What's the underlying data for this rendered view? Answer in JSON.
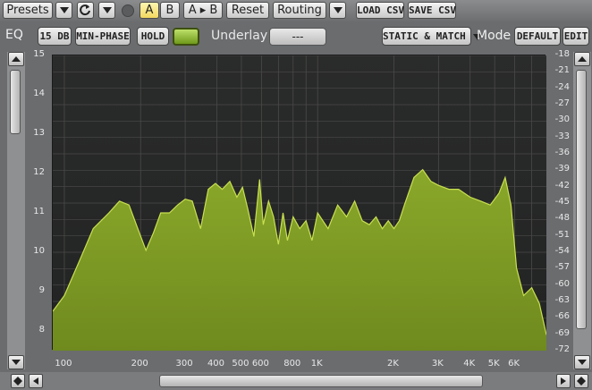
{
  "toolbar": {
    "presets_label": "Presets",
    "ab_a": "A",
    "ab_b": "B",
    "ab_copy": "A ▸ B",
    "reset_label": "Reset",
    "routing_label": "Routing",
    "load_csv": "LOAD CSV",
    "save_csv": "SAVE CSV"
  },
  "row2": {
    "eq_label": "EQ",
    "range_label": "15 DB",
    "phase_label": "MIN-PHASE",
    "hold_label": "HOLD",
    "underlay_label": "Underlay",
    "underlay_value": "---",
    "match_mode": "STATIC & MATCH",
    "mode_label": "Mode",
    "mode_value": "DEFAULT",
    "edit_label": "EDIT"
  },
  "colors": {
    "spectrum_fill": "#6f8a1e",
    "spectrum_line": "#c8e050",
    "grid": "#4a4a48",
    "accent": "#f2d860"
  },
  "chart_data": {
    "type": "area",
    "x_scale": "log",
    "x_ticks": [
      "100",
      "200",
      "300",
      "400",
      "500",
      "600",
      "800",
      "1K",
      "2K",
      "3K",
      "4K",
      "5K",
      "6K"
    ],
    "x_tick_values": [
      100,
      200,
      300,
      400,
      500,
      600,
      800,
      1000,
      2000,
      3000,
      4000,
      5000,
      6000
    ],
    "xlim": [
      90,
      8000
    ],
    "y_left_ticks": [
      "15",
      "14",
      "13",
      "12",
      "11",
      "10",
      "9",
      "8"
    ],
    "ylim_left": [
      7.5,
      15
    ],
    "y_right_ticks": [
      "-18",
      "-21",
      "-24",
      "-27",
      "-30",
      "-33",
      "-36",
      "-39",
      "-42",
      "-45",
      "-48",
      "-51",
      "-54",
      "-57",
      "-60",
      "-63",
      "-66",
      "-69",
      "-72"
    ],
    "ylim_right": [
      -72,
      -18
    ],
    "grid": true,
    "series": [
      {
        "x": [
          90,
          100,
          115,
          130,
          150,
          165,
          180,
          195,
          210,
          225,
          240,
          260,
          280,
          300,
          320,
          345,
          370,
          395,
          420,
          450,
          480,
          505,
          530,
          560,
          590,
          610,
          640,
          670,
          700,
          730,
          760,
          800,
          850,
          900,
          950,
          1000,
          1100,
          1200,
          1300,
          1400,
          1500,
          1600,
          1700,
          1800,
          1900,
          2000,
          2100,
          2200,
          2400,
          2600,
          2800,
          3000,
          3300,
          3600,
          4000,
          4400,
          4800,
          5200,
          5500,
          5800,
          6100,
          6500,
          7000,
          7500,
          8000
        ],
        "y": [
          8.5,
          8.9,
          9.8,
          10.6,
          11.0,
          11.3,
          11.2,
          10.6,
          10.05,
          10.5,
          11.0,
          11.0,
          11.2,
          11.35,
          11.3,
          10.6,
          11.6,
          11.75,
          11.6,
          11.8,
          11.4,
          11.65,
          11.1,
          10.4,
          11.85,
          10.7,
          11.3,
          10.9,
          10.2,
          11.0,
          10.3,
          10.9,
          10.6,
          10.8,
          10.3,
          11.0,
          10.6,
          11.2,
          10.9,
          11.3,
          10.8,
          10.7,
          10.9,
          10.6,
          10.8,
          10.6,
          10.8,
          11.2,
          11.9,
          12.1,
          11.8,
          11.7,
          11.6,
          11.6,
          11.4,
          11.3,
          11.2,
          11.5,
          11.9,
          11.2,
          9.6,
          8.9,
          9.1,
          8.7,
          7.9
        ]
      }
    ]
  }
}
